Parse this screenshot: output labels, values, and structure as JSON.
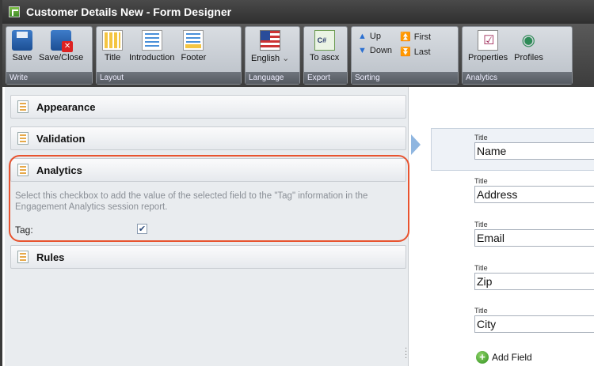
{
  "window": {
    "title": "Customer Details New - Form Designer"
  },
  "ribbon": {
    "write": {
      "label": "Write",
      "save": "Save",
      "save_close": "Save/Close"
    },
    "layout": {
      "label": "Layout",
      "title": "Title",
      "introduction": "Introduction",
      "footer": "Footer"
    },
    "language": {
      "label": "Language",
      "value": "English"
    },
    "export": {
      "label": "Export",
      "to_ascx": "To ascx"
    },
    "sorting": {
      "label": "Sorting",
      "up": "Up",
      "down": "Down",
      "first": "First",
      "last": "Last"
    },
    "analytics": {
      "label": "Analytics",
      "properties": "Properties",
      "profiles": "Profiles"
    }
  },
  "left_pane": {
    "sections": [
      {
        "label": "Appearance"
      },
      {
        "label": "Validation"
      },
      {
        "label": "Analytics"
      },
      {
        "label": "Rules"
      }
    ],
    "analytics": {
      "help_text": "Select this checkbox to add the value of the selected field to the \"Tag\" information in the Engagement Analytics session report.",
      "tag_label": "Tag:",
      "tag_checked": true
    }
  },
  "right_pane": {
    "fields": [
      {
        "label": "Title",
        "value": "Name",
        "selected": true
      },
      {
        "label": "Title",
        "value": "Address"
      },
      {
        "label": "Title",
        "value": "Email"
      },
      {
        "label": "Title",
        "value": "Zip"
      },
      {
        "label": "Title",
        "value": "City"
      }
    ],
    "add_field": "Add Field"
  },
  "colors": {
    "highlight": "#e8532f",
    "accent": "#8fb6e0"
  }
}
